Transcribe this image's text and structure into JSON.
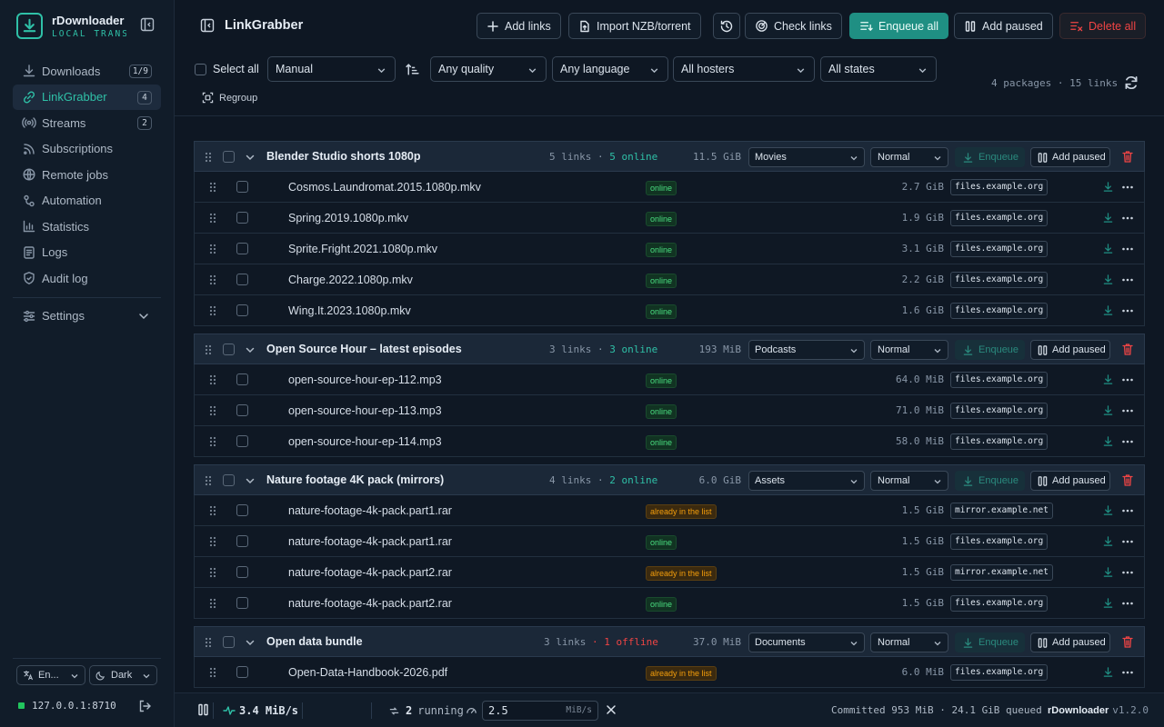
{
  "app": {
    "name": "rDownloader",
    "subtitle": "LOCAL TRANSFER"
  },
  "sidebar": {
    "items": [
      {
        "label": "Downloads",
        "badge": "1/9",
        "icon": "download-icon"
      },
      {
        "label": "LinkGrabber",
        "badge": "4",
        "icon": "link-grabber-icon",
        "active": true
      },
      {
        "label": "Streams",
        "badge": "2",
        "icon": "broadcast-icon"
      },
      {
        "label": "Subscriptions",
        "icon": "rss-icon"
      },
      {
        "label": "Remote jobs",
        "icon": "globe-icon"
      },
      {
        "label": "Automation",
        "icon": "workflow-icon"
      },
      {
        "label": "Statistics",
        "icon": "bar-chart-icon"
      },
      {
        "label": "Logs",
        "icon": "log-icon"
      },
      {
        "label": "Audit log",
        "icon": "shield-icon"
      }
    ],
    "settings_label": "Settings",
    "language": "En...",
    "theme": "Dark",
    "server": "127.0.0.1:8710"
  },
  "header": {
    "title": "LinkGrabber",
    "add_links": "Add links",
    "import": "Import NZB/torrent",
    "check_links": "Check links",
    "enqueue_all": "Enqueue all",
    "add_paused": "Add paused",
    "delete_all": "Delete all"
  },
  "toolbar": {
    "select_all": "Select all",
    "sort": "Manual",
    "quality": "Any quality",
    "language": "Any language",
    "hosters": "All hosters",
    "states": "All states",
    "regroup": "Regroup",
    "counts": "4 packages · 15 links"
  },
  "package_actions": {
    "enqueue": "Enqueue",
    "add_paused": "Add paused"
  },
  "packages": [
    {
      "name": "Blender Studio shorts 1080p",
      "links": "5 links",
      "state": "5 online",
      "state_kind": "ok",
      "size": "11.5 GiB",
      "category": "Movies",
      "priority": "Normal",
      "files": [
        {
          "name": "Cosmos.Laundromat.2015.1080p.mkv",
          "status": "online",
          "size": "2.7 GiB",
          "host": "files.example.org"
        },
        {
          "name": "Spring.2019.1080p.mkv",
          "status": "online",
          "size": "1.9 GiB",
          "host": "files.example.org"
        },
        {
          "name": "Sprite.Fright.2021.1080p.mkv",
          "status": "online",
          "size": "3.1 GiB",
          "host": "files.example.org"
        },
        {
          "name": "Charge.2022.1080p.mkv",
          "status": "online",
          "size": "2.2 GiB",
          "host": "files.example.org"
        },
        {
          "name": "Wing.It.2023.1080p.mkv",
          "status": "online",
          "size": "1.6 GiB",
          "host": "files.example.org"
        }
      ]
    },
    {
      "name": "Open Source Hour – latest episodes",
      "links": "3 links",
      "state": "3 online",
      "state_kind": "ok",
      "size": "193 MiB",
      "category": "Podcasts",
      "priority": "Normal",
      "files": [
        {
          "name": "open-source-hour-ep-112.mp3",
          "status": "online",
          "size": "64.0 MiB",
          "host": "files.example.org"
        },
        {
          "name": "open-source-hour-ep-113.mp3",
          "status": "online",
          "size": "71.0 MiB",
          "host": "files.example.org"
        },
        {
          "name": "open-source-hour-ep-114.mp3",
          "status": "online",
          "size": "58.0 MiB",
          "host": "files.example.org"
        }
      ]
    },
    {
      "name": "Nature footage 4K pack (mirrors)",
      "links": "4 links",
      "state": "2 online",
      "state_kind": "ok",
      "size": "6.0 GiB",
      "category": "Assets",
      "priority": "Normal",
      "files": [
        {
          "name": "nature-footage-4k-pack.part1.rar",
          "status": "already in the list",
          "size": "1.5 GiB",
          "host": "mirror.example.net"
        },
        {
          "name": "nature-footage-4k-pack.part1.rar",
          "status": "online",
          "size": "1.5 GiB",
          "host": "files.example.org"
        },
        {
          "name": "nature-footage-4k-pack.part2.rar",
          "status": "already in the list",
          "size": "1.5 GiB",
          "host": "mirror.example.net"
        },
        {
          "name": "nature-footage-4k-pack.part2.rar",
          "status": "online",
          "size": "1.5 GiB",
          "host": "files.example.org"
        }
      ]
    },
    {
      "name": "Open data bundle",
      "links": "3 links",
      "state": "1 offline",
      "state_kind": "bad",
      "size": "37.0 MiB",
      "category": "Documents",
      "priority": "Normal",
      "files": [
        {
          "name": "Open-Data-Handbook-2026.pdf",
          "status": "already in the list",
          "size": "6.0 MiB",
          "host": "files.example.org"
        }
      ]
    }
  ],
  "statusbar": {
    "speed": "3.4 MiB/s",
    "running_count": "2",
    "running_label": "running",
    "limit_value": "2.5",
    "limit_unit": "MiB/s",
    "summary": "Committed 953 MiB · 24.1 GiB queued",
    "app": "rDownloader",
    "version": "v1.2.0"
  },
  "colors": {
    "accent": "#2fc0a7",
    "danger": "#ef4444",
    "online": "#4ade80",
    "duplicate": "#f59e0b"
  }
}
